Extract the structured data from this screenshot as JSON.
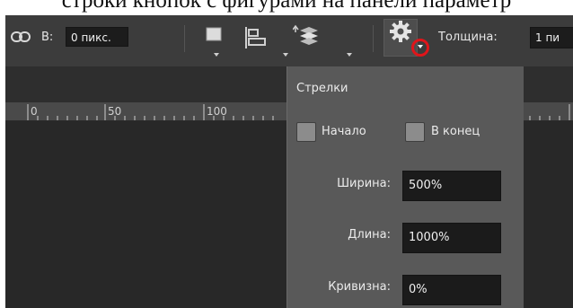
{
  "caption": "строки кнопок с фигурами на панели параметр",
  "options_bar": {
    "link_icon": "link-icon",
    "b_label": "В:",
    "b_value": "0 пикс.",
    "square_icon": "fill-square-icon",
    "align_icon": "align-left-icon",
    "arrange_icon": "arrange-layers-icon",
    "gear_icon": "gear-icon",
    "thickness_label": "Толщина:",
    "thickness_value": "1 пи"
  },
  "ruler": {
    "ticks": [
      "0",
      "50",
      "100"
    ]
  },
  "arrows_panel": {
    "title": "Стрелки",
    "start_label": "Начало",
    "end_label": "В конец",
    "width_label": "Ширина:",
    "width_value": "500%",
    "length_label": "Длина:",
    "length_value": "1000%",
    "concavity_label": "Кривизна:",
    "concavity_value": "0%"
  },
  "colors": {
    "highlight_circle": "#e0151a",
    "panel_bg": "#595959",
    "optbar_bg": "#3c3c3c"
  }
}
